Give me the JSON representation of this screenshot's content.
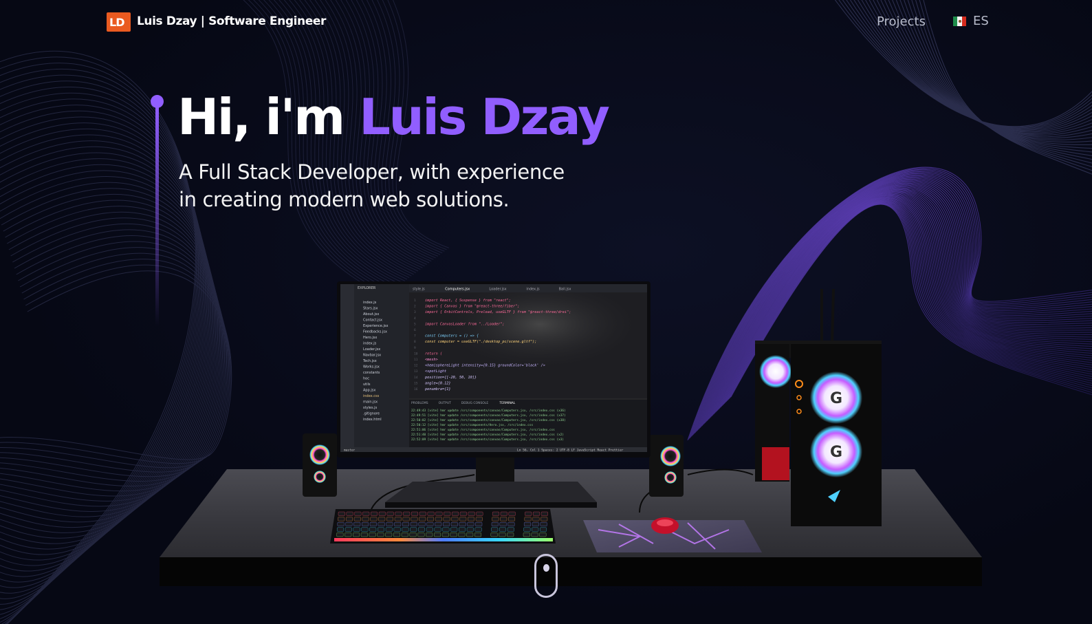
{
  "header": {
    "logo_text": "LD",
    "brand": "Luis Dzay | Software Engineer",
    "nav_projects": "Projects",
    "lang_label": "ES"
  },
  "hero": {
    "greeting": "Hi, i'm ",
    "name": "Luis Dzay",
    "subtitle_line1": "A Full Stack Developer, with experience",
    "subtitle_line2": "in creating modern web solutions."
  },
  "editor": {
    "tabs": [
      "style.js",
      "Computers.jsx",
      "Loader.jsx",
      "index.js",
      "Ball.jsx"
    ],
    "explorer_title": "EXPLORER",
    "files": [
      "index.js",
      "Stars.jsx",
      "About.jsx",
      "Contact.jsx",
      "Experience.jsx",
      "Feedbacks.jsx",
      "Hero.jsx",
      "index.js",
      "Loader.jsx",
      "Navbar.jsx",
      "Tech.jsx",
      "Works.jsx",
      "constants",
      "hoc",
      "utils",
      "App.jsx",
      "index.css",
      "main.jsx",
      "styles.js",
      ".gitignore",
      "index.html"
    ],
    "code_lines": [
      "import React, { Suspense } from \"react\";",
      "import { Canvas } from \"@react-three/fiber\";",
      "import { OrbitControls, Preload, useGLTF } from \"@react-three/drei\";",
      "",
      "import CanvasLoader from \"../Loader\";",
      "",
      "const Computers = () => {",
      "  const computer = useGLTF(\"./desktop_pc/scene.gltf\");",
      "",
      "  return (",
      "    <mesh>",
      "      <hemisphereLight intensity={0.15} groundColor='black' />",
      "      <spotLight",
      "        position={[-20, 50, 10]}",
      "        angle={0.12}",
      "        penumbra={1}"
    ],
    "panel_tabs": [
      "PROBLEMS",
      "OUTPUT",
      "DEBUG CONSOLE",
      "TERMINAL"
    ],
    "terminal_lines": [
      "22:49:43 [vite] hmr update /src/components/canvas/Computers.jsx, /src/index.css (x36)",
      "22:49:51 [vite] hmr update /src/components/canvas/Computers.jsx, /src/index.css (x37)",
      "22:50:02 [vite] hmr update /src/components/canvas/Computers.jsx, /src/index.css (x38)",
      "22:50:12 [vite] hmr update /src/components/Hero.jsx, /src/index.css",
      "22:51:06 [vite] hmr update /src/components/canvas/Computers.jsx, /src/index.css",
      "22:51:40 [vite] hmr update /src/components/canvas/Computers.jsx, /src/index.css (x2)",
      "22:52:09 [vite] hmr update /src/components/canvas/Computers.jsx, /src/index.css (x3)"
    ],
    "status_left": "master",
    "status_right": "Ln 56, Col 1   Spaces: 2   UTF-8   LF   JavaScript React   Prettier"
  },
  "colors": {
    "accent": "#915eff",
    "logo": "#ea5a20",
    "background": "#060814"
  }
}
